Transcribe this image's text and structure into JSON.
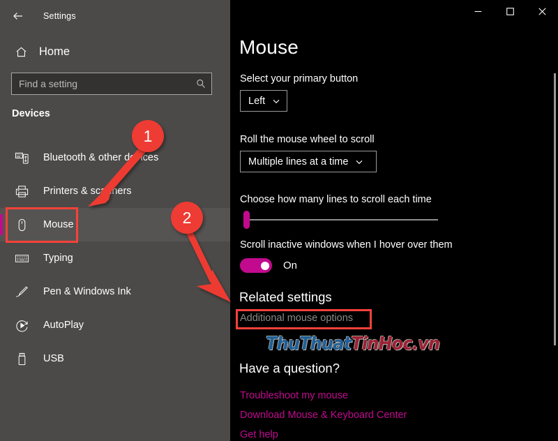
{
  "window": {
    "back_icon": "back-arrow-icon",
    "app_title": "Settings",
    "minimize_label": "─",
    "maximize_label": "□",
    "close_label": "✕"
  },
  "sidebar": {
    "home_label": "Home",
    "home_icon": "home-icon",
    "search": {
      "placeholder": "Find a setting",
      "value": "",
      "icon": "search-icon"
    },
    "group_header": "Devices",
    "items": [
      {
        "label": "Bluetooth & other devices",
        "icon": "bluetooth-devices-icon",
        "selected": false
      },
      {
        "label": "Printers & scanners",
        "icon": "printer-icon",
        "selected": false
      },
      {
        "label": "Mouse",
        "icon": "mouse-icon",
        "selected": true
      },
      {
        "label": "Typing",
        "icon": "keyboard-icon",
        "selected": false
      },
      {
        "label": "Pen & Windows Ink",
        "icon": "pen-icon",
        "selected": false
      },
      {
        "label": "AutoPlay",
        "icon": "autoplay-icon",
        "selected": false
      },
      {
        "label": "USB",
        "icon": "usb-icon",
        "selected": false
      }
    ]
  },
  "main": {
    "page_title": "Mouse",
    "primary_button": {
      "label": "Select your primary button",
      "value": "Left",
      "chevron_icon": "chevron-down-icon"
    },
    "wheel_scroll": {
      "label": "Roll the mouse wheel to scroll",
      "value": "Multiple lines at a time",
      "chevron_icon": "chevron-down-icon"
    },
    "lines_slider": {
      "label": "Choose how many lines to scroll each time",
      "position_percent": 2
    },
    "scroll_inactive": {
      "label": "Scroll inactive windows when I hover over them",
      "state": "On",
      "enabled": true
    },
    "related_settings": {
      "heading": "Related settings",
      "link": "Additional mouse options"
    },
    "help": {
      "heading": "Have a question?",
      "links": [
        "Troubleshoot my mouse",
        "Download Mouse & Keyboard Center",
        "Get help"
      ]
    },
    "scrollbar_icon": "vertical-scrollbar"
  },
  "watermark": {
    "part1": "ThuThuat",
    "part2": "TinHoc.vn"
  },
  "annotations": {
    "badge1": "1",
    "badge2": "2",
    "accent_color": "#c20a8e",
    "marker_color": "#ee3b33"
  }
}
